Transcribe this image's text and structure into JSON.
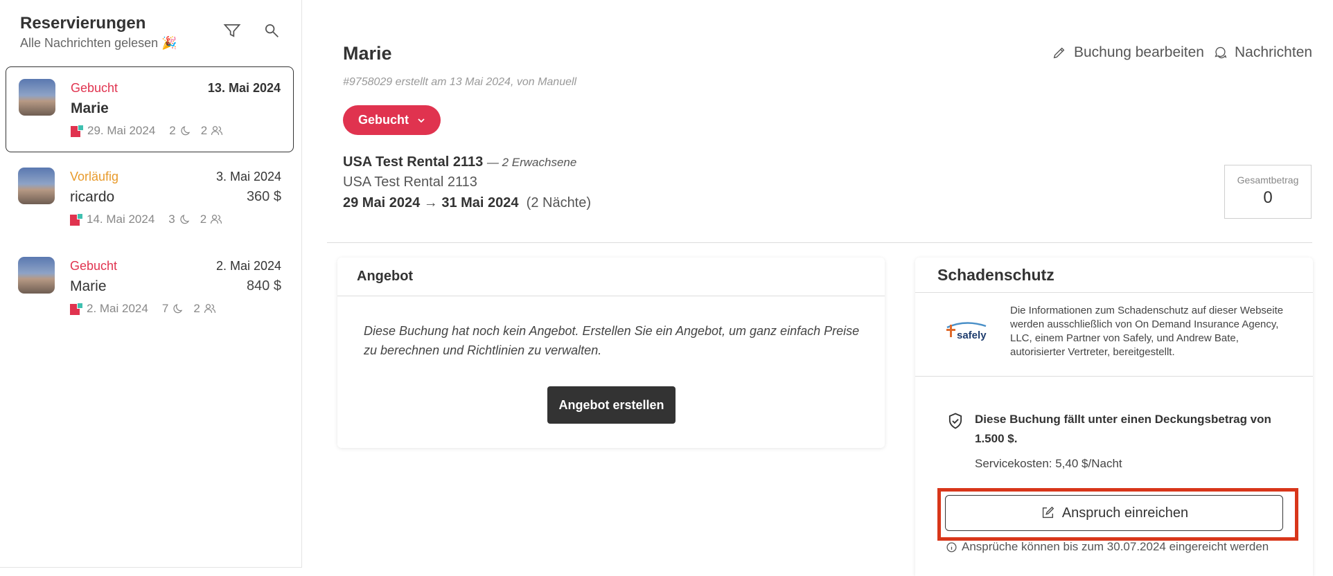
{
  "sidebar": {
    "title": "Reservierungen",
    "subtitle": "Alle Nachrichten gelesen 🎉",
    "icons": {
      "filter": "filter-icon",
      "search": "search-icon"
    },
    "reservations": [
      {
        "status": "Gebucht",
        "status_color": "#e0334f",
        "date": "13. Mai 2024",
        "name": "Marie",
        "price": "",
        "checkin": "29. Mai 2024",
        "nights": "2",
        "guests": "2",
        "selected": true
      },
      {
        "status": "Vorläufig",
        "status_color": "#e89a2b",
        "date": "3. Mai 2024",
        "name": "ricardo",
        "price": "360 $",
        "checkin": "14. Mai 2024",
        "nights": "3",
        "guests": "2",
        "selected": false
      },
      {
        "status": "Gebucht",
        "status_color": "#e0334f",
        "date": "2. Mai 2024",
        "name": "Marie",
        "price": "840 $",
        "checkin": "2. Mai 2024",
        "nights": "7",
        "guests": "2",
        "selected": false
      }
    ]
  },
  "main": {
    "title": "Marie",
    "subtitle": "#9758029 erstellt am 13 Mai 2024, von Manuell",
    "edit_label": "Buchung bearbeiten",
    "messages_label": "Nachrichten",
    "status_button": "Gebucht",
    "rental_name": "USA Test Rental 2113",
    "rental_guests": "— 2 Erwachsene",
    "rental_name2": "USA Test Rental 2113",
    "date_from": "29 Mai 2024",
    "date_to": "31 Mai 2024",
    "nights_label": "(2 Nächte)",
    "total_label": "Gesamtbetrag",
    "total_value": "0"
  },
  "offer": {
    "title": "Angebot",
    "text": "Diese Buchung hat noch kein Angebot. Erstellen Sie ein Angebot, um ganz einfach Preise zu berechnen und Richtlinien zu verwalten.",
    "button": "Angebot erstellen"
  },
  "damage": {
    "title": "Schadenschutz",
    "logo_text": "safely",
    "info": "Die Informationen zum Schadenschutz auf dieser Webseite werden ausschließlich von On Demand Insurance Agency, LLC, einem Partner von Safely, und Andrew Bate, autorisierter Vertreter, bereitgestellt.",
    "coverage": "Diese Buchung fällt unter einen Deckungsbetrag von 1.500 $.",
    "fee": "Servicekosten: 5,40 $/Nacht",
    "claim_button": "Anspruch einreichen",
    "claim_note": "Ansprüche können bis zum 30.07.2024 eingereicht werden"
  },
  "colors": {
    "accent": "#e0334f",
    "pending": "#e89a2b",
    "dark_button": "#333333",
    "highlight": "#d8361a"
  }
}
